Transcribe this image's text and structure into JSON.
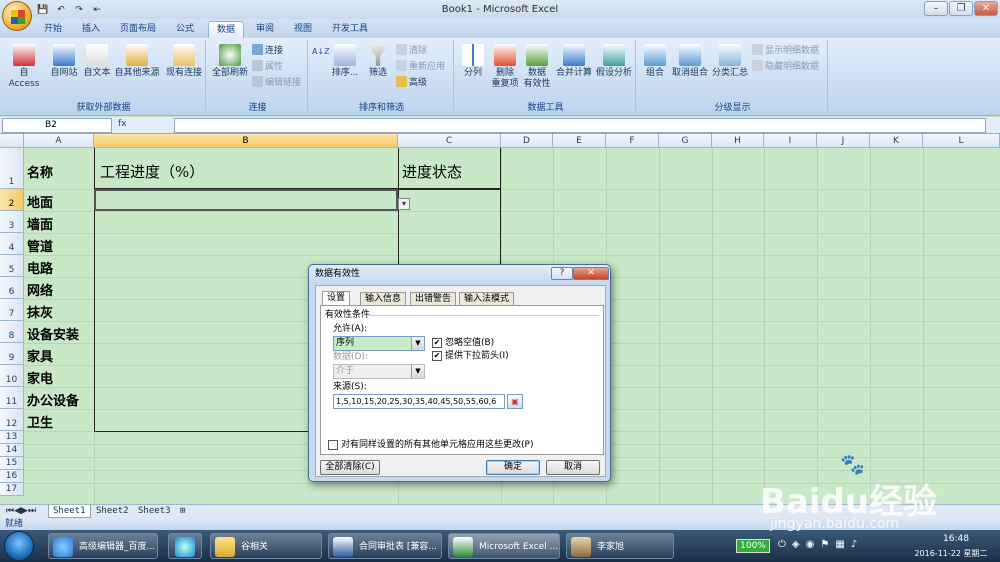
{
  "window": {
    "title": "Book1 - Microsoft Excel",
    "min": "–",
    "restore": "❐",
    "close": "✕"
  },
  "qat": {
    "save": "💾",
    "undo": "↶",
    "redo": "↷",
    "extra": "⇤"
  },
  "tabs": [
    "开始",
    "插入",
    "页面布局",
    "公式",
    "数据",
    "审阅",
    "视图",
    "开发工具"
  ],
  "active_tab": "数据",
  "ribbon": {
    "g1": {
      "label": "获取外部数据",
      "buttons": [
        "自 Access",
        "自网站",
        "自文本",
        "自其他来源",
        "现有连接"
      ]
    },
    "g2": {
      "label": "连接",
      "big": "全部刷新",
      "small": [
        "连接",
        "属性",
        "编辑链接"
      ]
    },
    "g3": {
      "label": "排序和筛选",
      "sortaz": "排序...",
      "filter": "筛选",
      "small": [
        "清除",
        "重新应用",
        "高级"
      ]
    },
    "g4": {
      "label": "数据工具",
      "buttons": [
        "分列",
        "删除\n重复项",
        "数据\n有效性",
        "合并计算",
        "假设分析"
      ]
    },
    "g5": {
      "label": "分级显示",
      "buttons": [
        "组合",
        "取消组合",
        "分类汇总"
      ],
      "small": [
        "显示明细数据",
        "隐藏明细数据"
      ]
    }
  },
  "formula": {
    "namebox": "B2",
    "fx": "fx",
    "value": ""
  },
  "columns": [
    "A",
    "B",
    "C",
    "D",
    "E",
    "F",
    "G",
    "H",
    "I",
    "J",
    "K",
    "L"
  ],
  "rows": [
    "1",
    "2",
    "3",
    "4",
    "5",
    "6",
    "7",
    "8",
    "9",
    "10",
    "11",
    "12",
    "13",
    "14",
    "15",
    "16",
    "17"
  ],
  "cells": {
    "A1": "名称",
    "B1": "工程进度（%）",
    "C1": "进度状态",
    "A": [
      "地面",
      "墙面",
      "管道",
      "电路",
      "网络",
      "抹灰",
      "设备安装",
      "家具",
      "家电",
      "办公设备",
      "卫生"
    ]
  },
  "sheets": [
    "Sheet1",
    "Sheet2",
    "Sheet3"
  ],
  "status": {
    "mode": "就绪"
  },
  "dialog": {
    "title": "数据有效性",
    "help": "?",
    "close": "✕",
    "tabs": [
      "设置",
      "输入信息",
      "出错警告",
      "输入法模式"
    ],
    "section": "有效性条件",
    "allow_label": "允许(A):",
    "allow_value": "序列",
    "data_label": "数据(D):",
    "data_value": "介于",
    "ignore_blank": "忽略空值(B)",
    "dropdown": "提供下拉箭头(I)",
    "source_label": "来源(S):",
    "source_value": "1,5,10,15,20,25,30,35,40,45,50,55,60,6",
    "apply_all": "对有同样设置的所有其他单元格应用这些更改(P)",
    "clear_all": "全部清除(C)",
    "ok": "确定",
    "cancel": "取消"
  },
  "taskbar": {
    "items": [
      "高级编辑器_百度...",
      "谷相关",
      "合同审批表 [兼容...",
      "Microsoft Excel ...",
      "李家旭"
    ],
    "battery": "100%",
    "time": "16:48",
    "date": "2016-11-22 星期二"
  },
  "watermark": {
    "brand": "Bai",
    "brand2": "经验",
    "url": "jingyan.baidu.com"
  }
}
